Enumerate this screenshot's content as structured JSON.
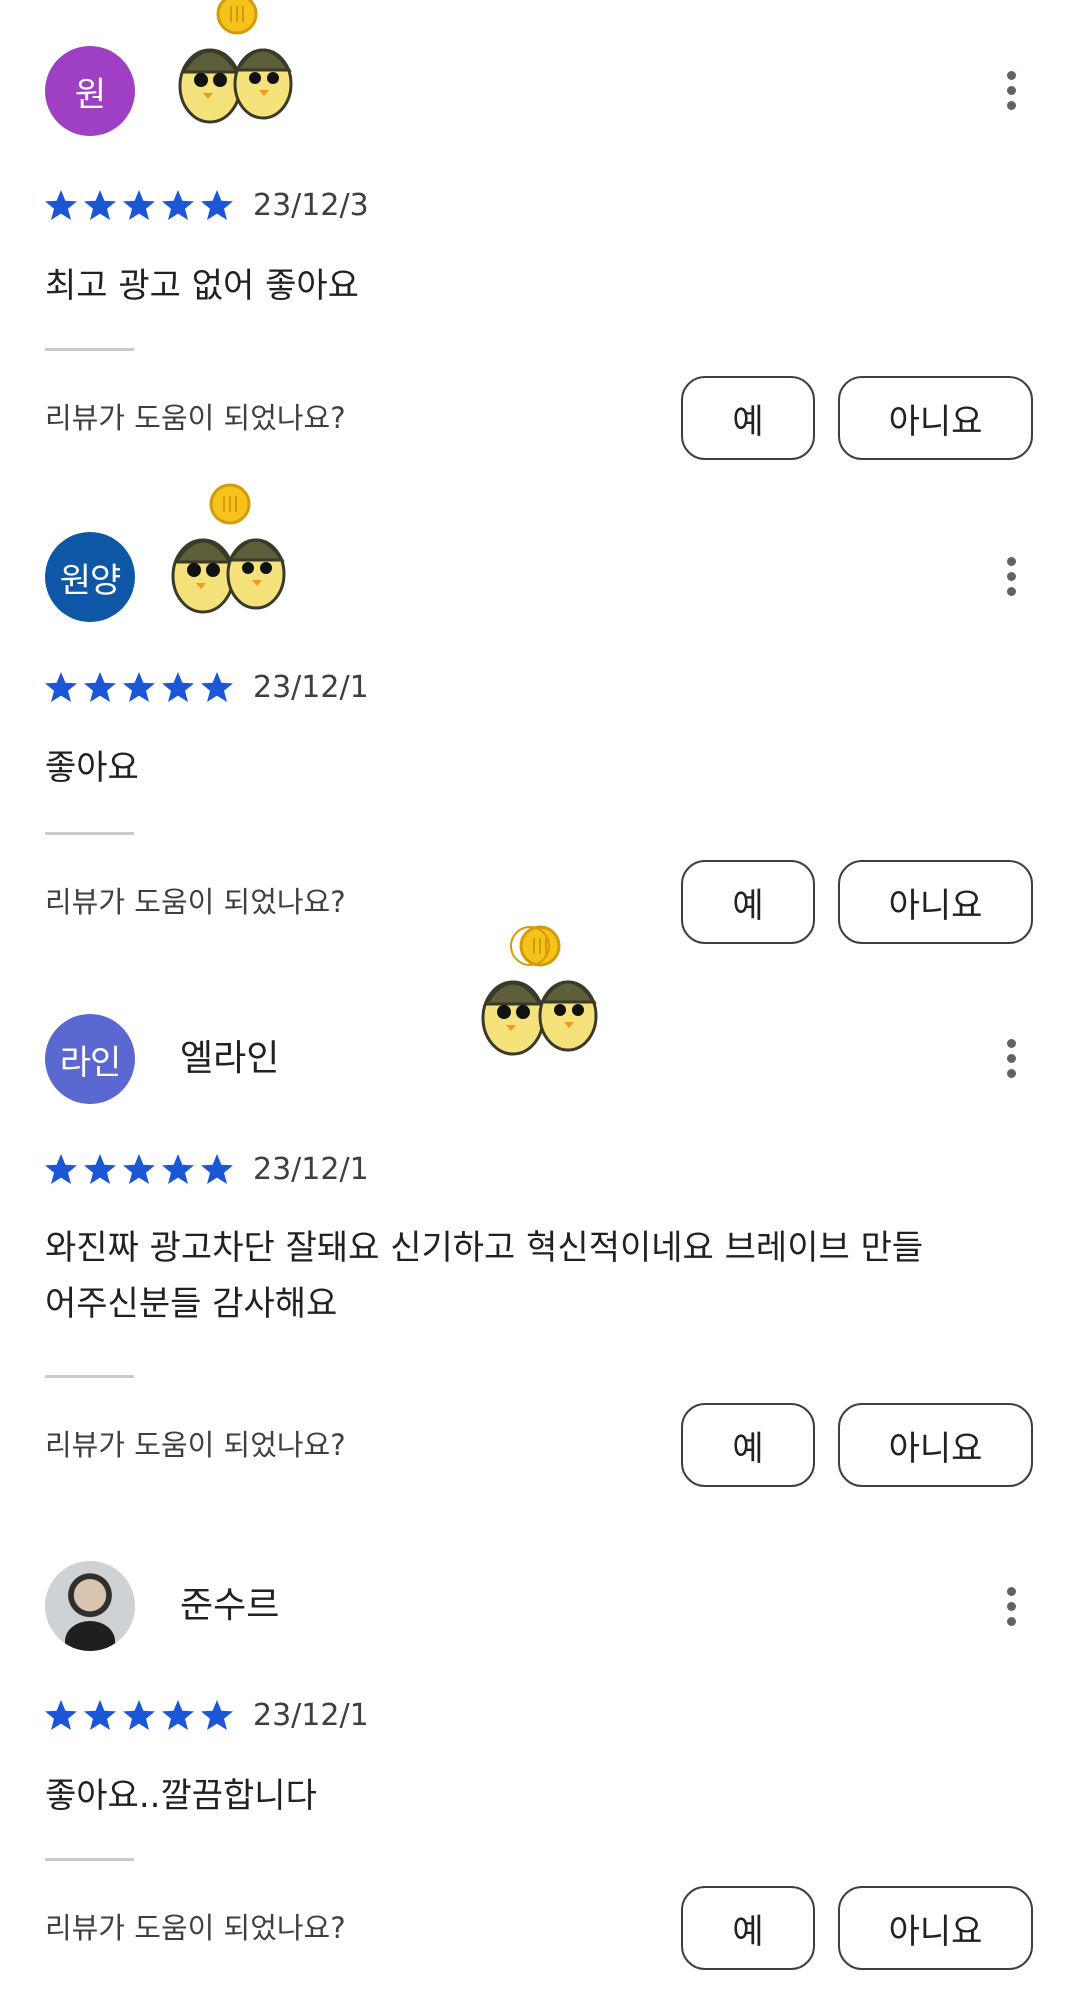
{
  "colors": {
    "star": "#1a56d6",
    "avatar_purple": "#9e3fc4",
    "avatar_navy": "#0d57a6",
    "avatar_indigo": "#5c68d2",
    "divider": "#c9cccf",
    "button_border": "#3c4043"
  },
  "reviews": [
    {
      "avatar_text": "원",
      "author": "",
      "sticker": "penguin-duo-coin-sticker",
      "rating": 5,
      "date": "23/12/3",
      "text": "최고 광고 없어 좋아요",
      "helpful_prompt": "리뷰가 도움이 되었나요?",
      "yes_label": "예",
      "no_label": "아니요"
    },
    {
      "avatar_text": "원양",
      "author": "",
      "sticker": "penguin-duo-coin-sticker",
      "rating": 5,
      "date": "23/12/1",
      "text": "좋아요",
      "helpful_prompt": "리뷰가 도움이 되었나요?",
      "yes_label": "예",
      "no_label": "아니요"
    },
    {
      "avatar_text": "라인",
      "author": "엘라인",
      "sticker": "penguin-duo-coin-sticker",
      "rating": 5,
      "date": "23/12/1",
      "text": "와진짜 광고차단 잘돼요 신기하고 혁신적이네요 브레이브 만들어주신분들 감사해요",
      "helpful_prompt": "리뷰가 도움이 되었나요?",
      "yes_label": "예",
      "no_label": "아니요"
    },
    {
      "avatar_text": "",
      "author": "준수르",
      "sticker": "",
      "rating": 5,
      "date": "23/12/1",
      "text": "좋아요..깔끔합니다",
      "helpful_prompt": "리뷰가 도움이 되었나요?",
      "yes_label": "예",
      "no_label": "아니요"
    }
  ]
}
